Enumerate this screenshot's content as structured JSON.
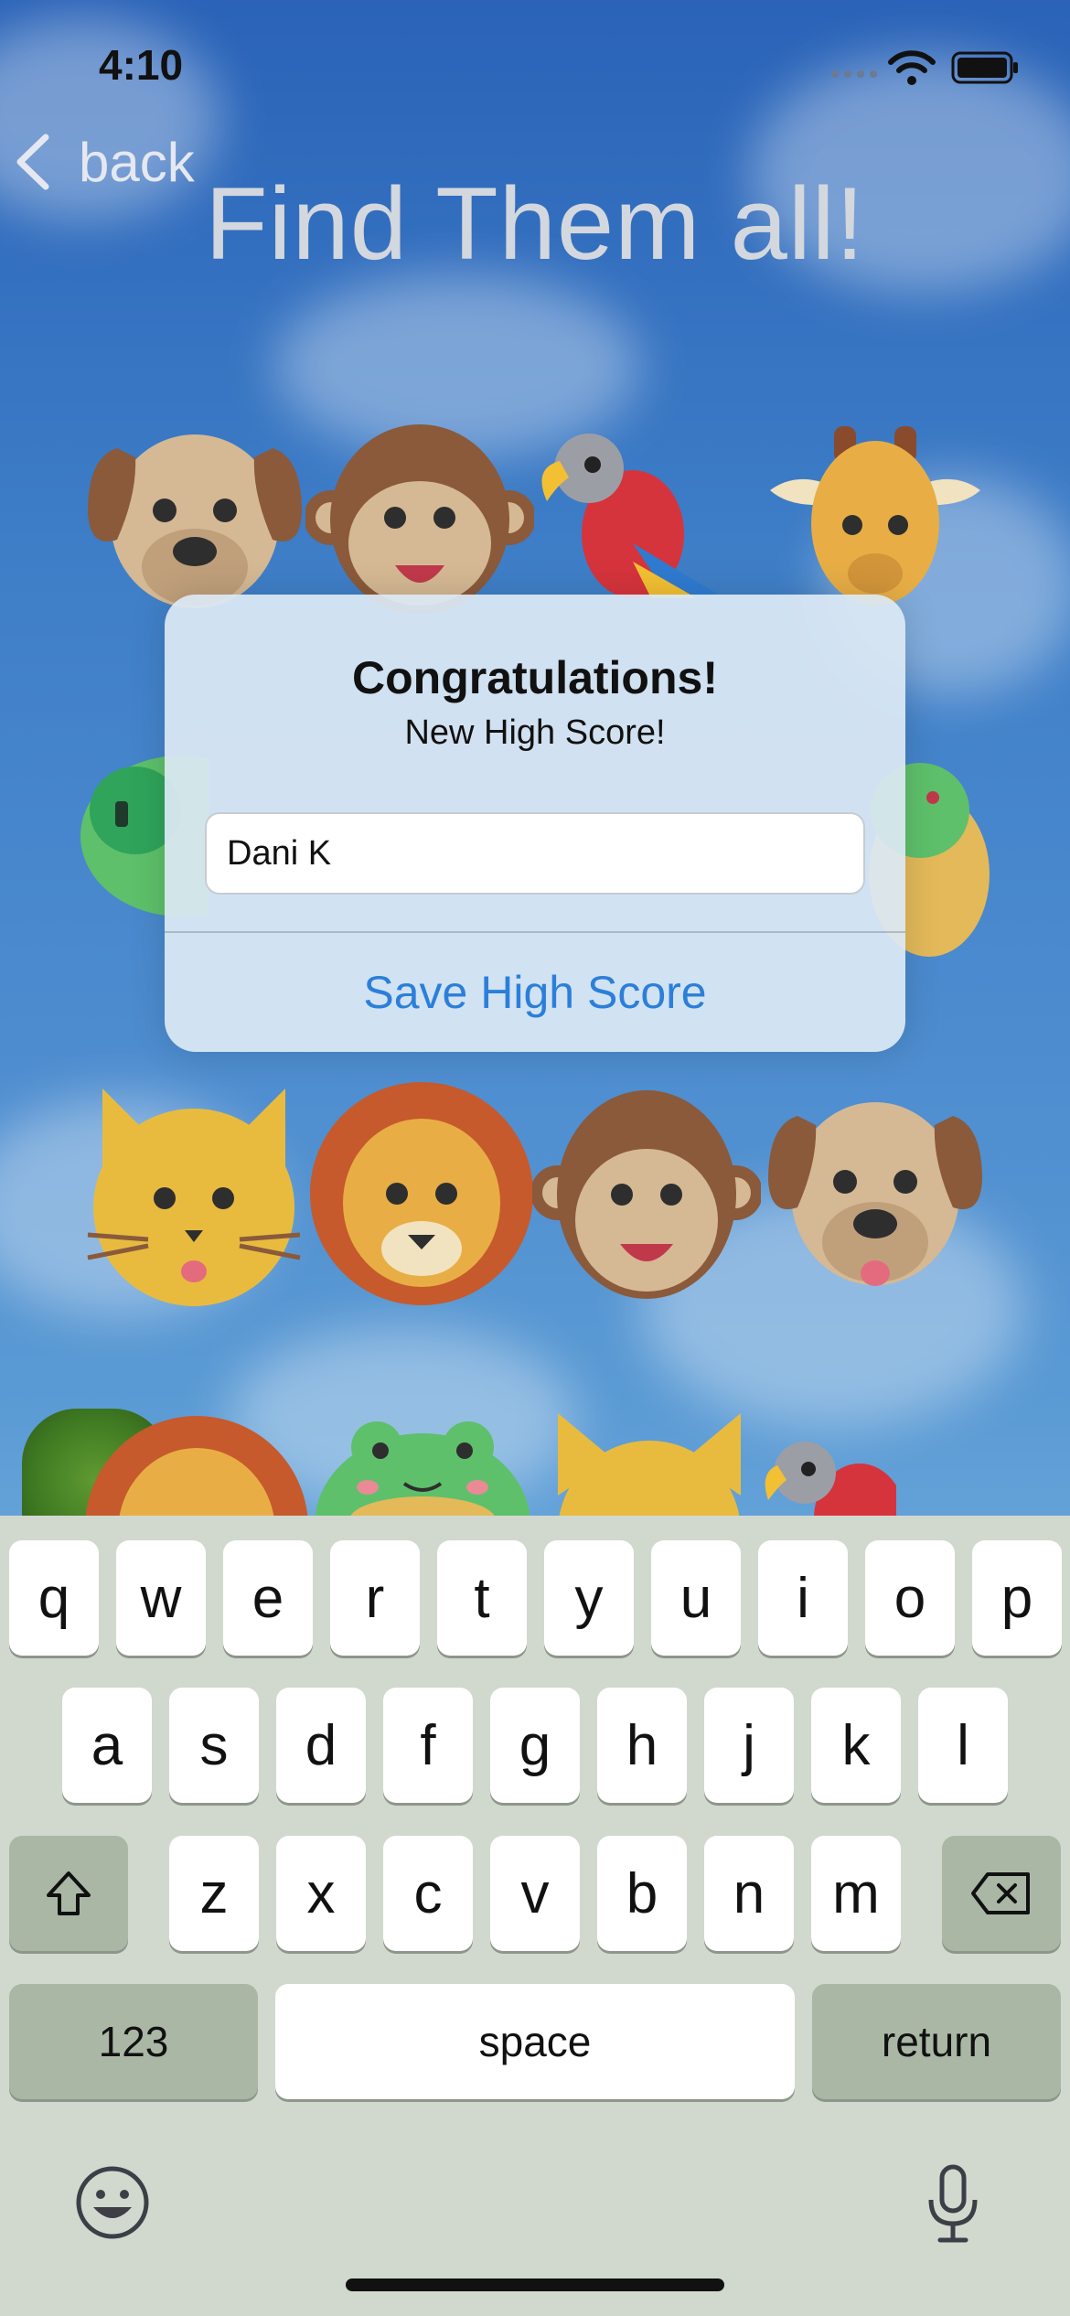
{
  "status_bar": {
    "time": "4:10",
    "icons": [
      "cellular-signal-icon",
      "wifi-icon",
      "battery-icon"
    ]
  },
  "nav": {
    "back_label": "back",
    "back_icon": "chevron-left-icon",
    "title": "Find Them all!"
  },
  "animals": [
    "dog",
    "monkey",
    "parrot",
    "giraffe",
    "frog",
    "frog",
    "cat",
    "lion",
    "monkey",
    "dog",
    "lion",
    "frog",
    "cat",
    "parrot"
  ],
  "dialog": {
    "title": "Congratulations!",
    "message": "New High Score!",
    "name_value": "Dani K",
    "save_label": "Save High Score"
  },
  "keyboard": {
    "row1": [
      "q",
      "w",
      "e",
      "r",
      "t",
      "y",
      "u",
      "i",
      "o",
      "p"
    ],
    "row2": [
      "a",
      "s",
      "d",
      "f",
      "g",
      "h",
      "j",
      "k",
      "l"
    ],
    "row3": [
      "z",
      "x",
      "c",
      "v",
      "b",
      "n",
      "m"
    ],
    "numbers_label": "123",
    "space_label": "space",
    "return_label": "return",
    "icons": [
      "shift-icon",
      "backspace-icon",
      "emoji-icon",
      "microphone-icon"
    ]
  },
  "colors": {
    "accent": "#2b7fd9",
    "sky": "#3f7fc8",
    "keyboard_bg": "#d1d9cf",
    "key_dark": "#aab7a5"
  }
}
